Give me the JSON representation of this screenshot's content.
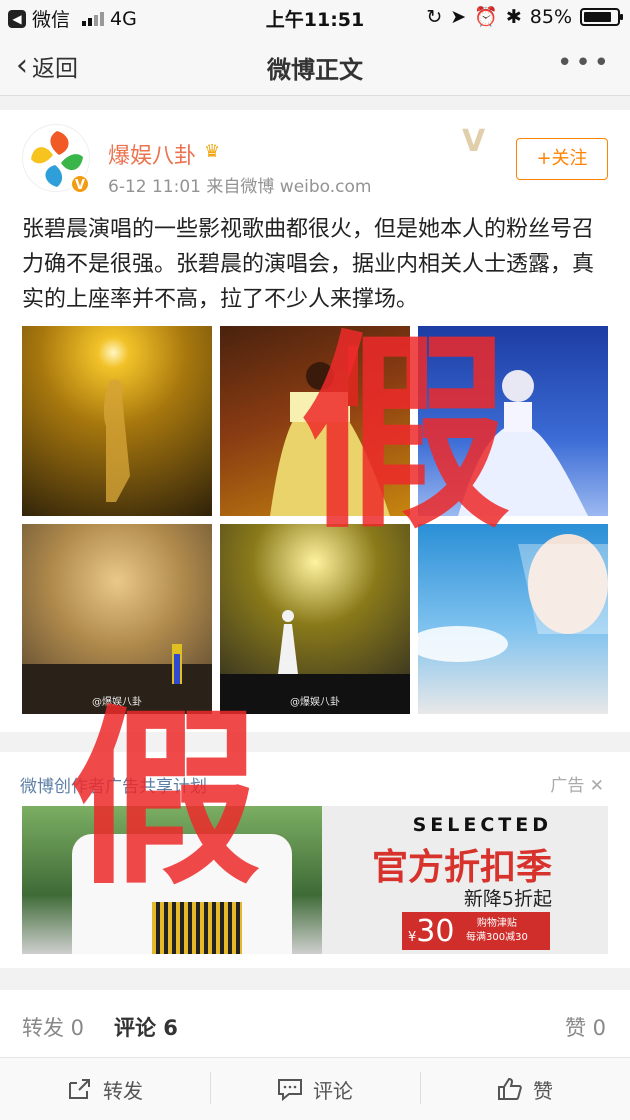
{
  "status_bar": {
    "back_app": "微信",
    "network": "4G",
    "time": "上午11:51",
    "battery": "85%",
    "battery_level": 0.85
  },
  "nav": {
    "back_label": "返回",
    "title": "微博正文"
  },
  "post": {
    "author": "爆娱八卦",
    "meta": "6-12 11:01  来自微博 weibo.com",
    "follow_label": "+关注",
    "text": "张碧晨演唱的一些影视歌曲都很火，但是她本人的粉丝号召力确不是很强。张碧晨的演唱会，据业内相关人士透露，真实的上座率并不高，拉了不少人来撑场。",
    "watermark": "@爆娱八卦",
    "stamp_char": "假"
  },
  "ad": {
    "plan": "微博创作者广告共享计划",
    "tag": "广告",
    "brand": "SELECTED",
    "headline": "官方折扣季",
    "subline": "新降5折起",
    "coupon_amount": "30",
    "coupon_currency": "¥",
    "coupon_title": "购物津贴",
    "coupon_rule": "每满300减30"
  },
  "stats": {
    "repost": "转发 0",
    "comment": "评论 6",
    "like": "赞 0"
  },
  "actions": {
    "repost": "转发",
    "comment": "评论",
    "like": "赞"
  },
  "colors": {
    "accent": "#ff8200",
    "username": "#eb7350",
    "stamp": "#ee2a2a",
    "link": "#5d7fa6"
  }
}
